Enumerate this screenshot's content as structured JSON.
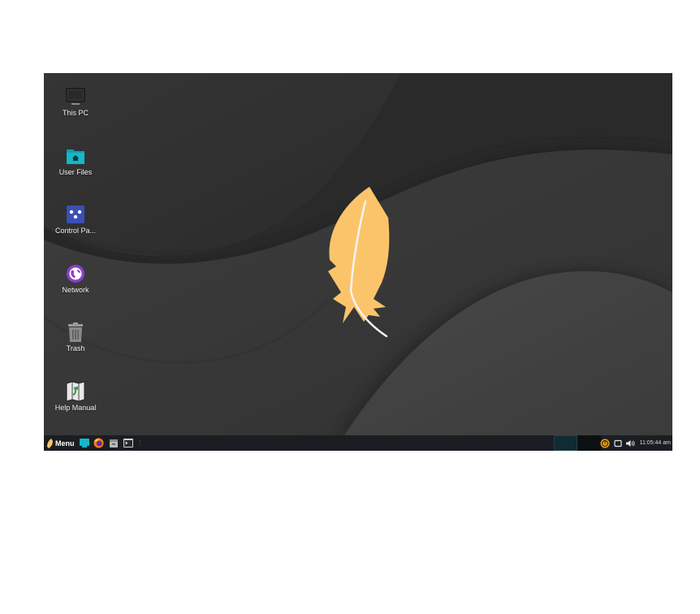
{
  "desktop": {
    "icons": [
      {
        "label": "This PC",
        "icon": "monitor-icon"
      },
      {
        "label": "User Files",
        "icon": "home-folder-icon"
      },
      {
        "label": "Control Pa...",
        "icon": "control-panel-icon"
      },
      {
        "label": "Network",
        "icon": "network-globe-icon"
      },
      {
        "label": "Trash",
        "icon": "trash-icon"
      },
      {
        "label": "Help Manual",
        "icon": "help-manual-icon"
      }
    ],
    "logo": "feather-logo"
  },
  "taskbar": {
    "menu_label": "Menu",
    "launchers": [
      "show-desktop-icon",
      "firefox-icon",
      "file-manager-icon",
      "terminal-icon"
    ],
    "clock": "11:05:44 am"
  },
  "colors": {
    "feather": "#fcc46a",
    "taskbar": "#1a1e22",
    "accent": "#14b8c8",
    "wallpaper_dark": "#2c2c2c",
    "wallpaper_light": "#444444"
  }
}
